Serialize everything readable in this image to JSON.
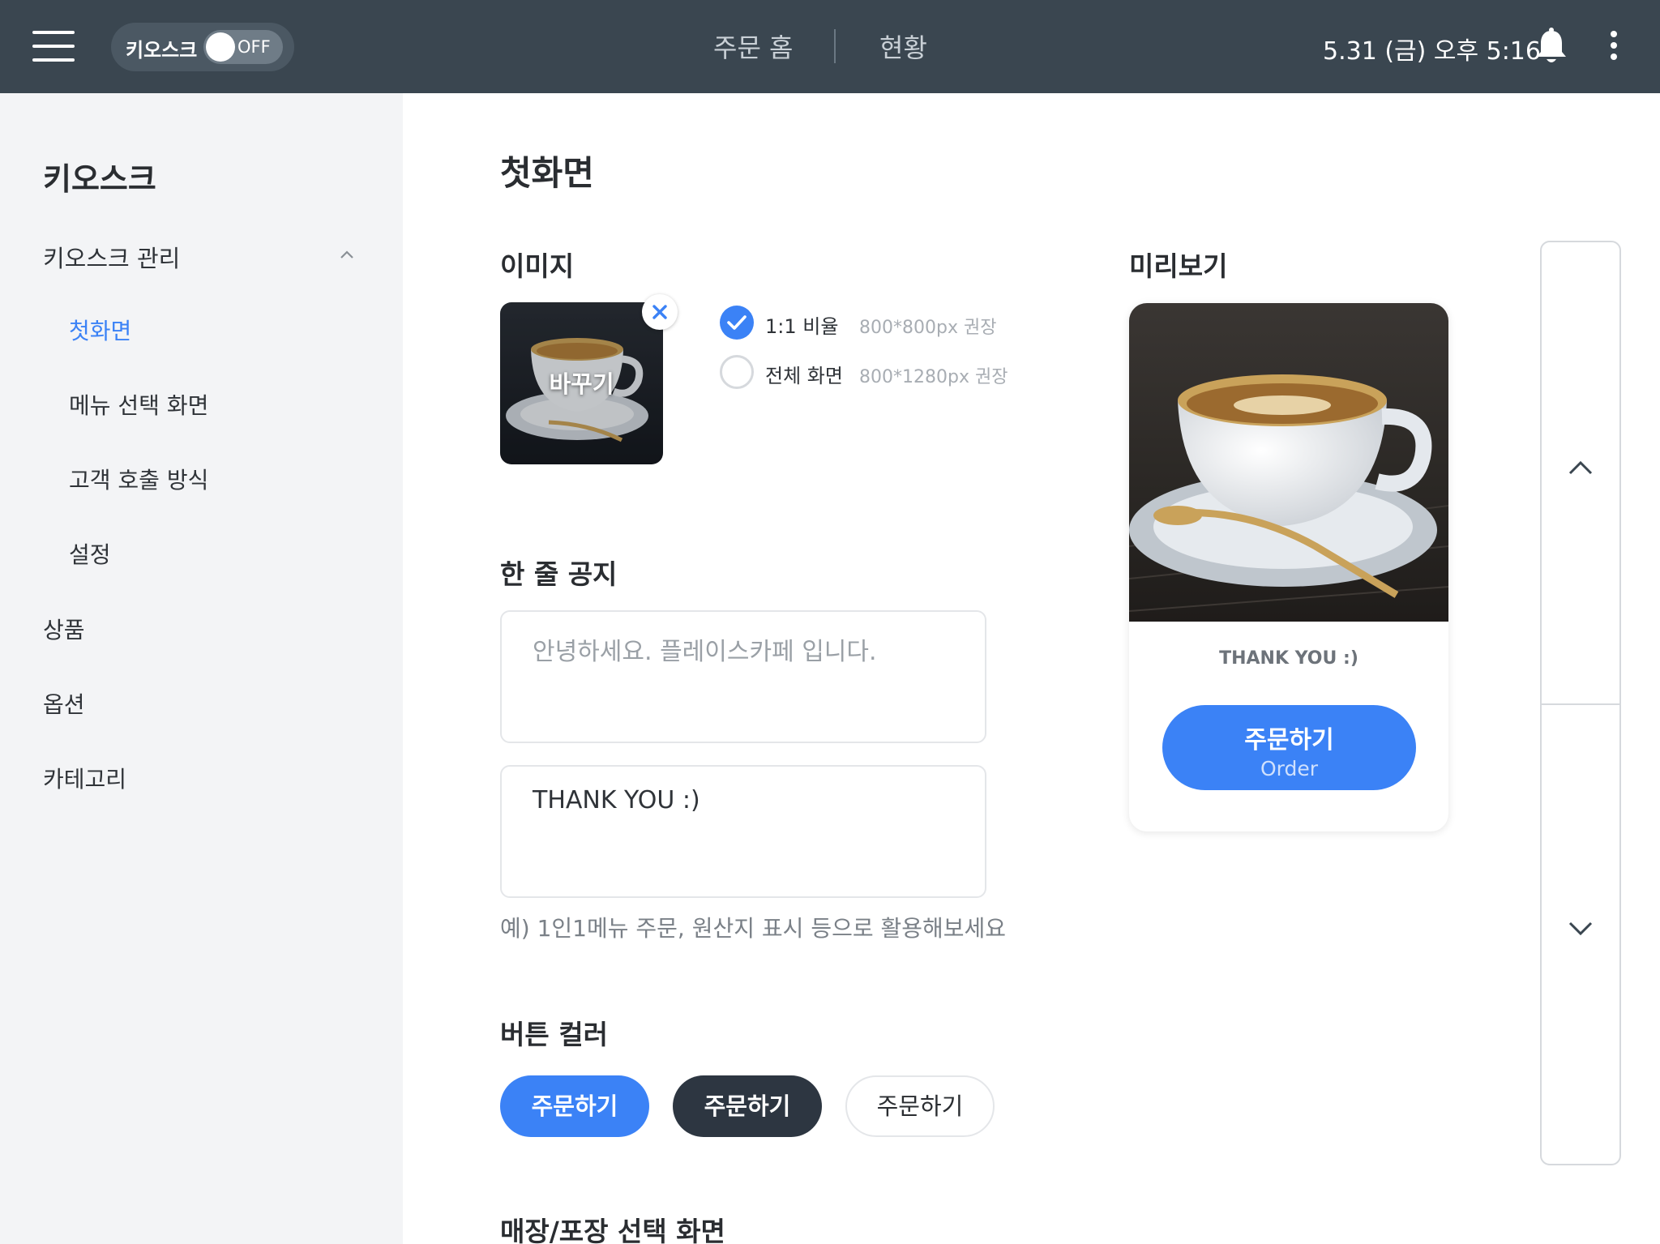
{
  "topbar": {
    "menu_icon": "hamburger-menu-icon",
    "kiosk_label": "키오스크",
    "toggle_state": "OFF",
    "nav_home": "주문 홈",
    "nav_status": "현황",
    "datetime": "5.31 (금) 오후 5:16",
    "bell_icon": "bell-icon",
    "more_icon": "more-vertical-icon"
  },
  "sidebar": {
    "title": "키오스크",
    "group_label": "키오스크 관리",
    "group_expanded": true,
    "sub_items": [
      "첫화면",
      "메뉴 선택 화면",
      "고객 호출 방식",
      "설정"
    ],
    "active_item": "첫화면",
    "top_items": [
      "상품",
      "옵션",
      "카테고리"
    ]
  },
  "main": {
    "title": "첫화면",
    "image_section": {
      "title": "이미지",
      "thumb_button": "바꾸기",
      "ratio_options": [
        {
          "label": "1:1 비율",
          "hint": "800*800px 권장",
          "selected": true
        },
        {
          "label": "전체 화면",
          "hint": "800*1280px 권장",
          "selected": false
        }
      ]
    },
    "notice_section": {
      "title": "한 줄 공지",
      "placeholder": "안녕하세요. 플레이스카페 입니다.",
      "value": "THANK YOU :)",
      "hint": "예) 1인1메뉴 주문, 원산지 표시 등으로 활용해보세요"
    },
    "color_section": {
      "title": "버튼 컬러",
      "options": [
        {
          "label": "주문하기",
          "color": "#3b82f6"
        },
        {
          "label": "주문하기",
          "color": "#2d3641"
        },
        {
          "label": "주문하기",
          "color": "#ffffff"
        }
      ]
    },
    "next_section_title": "매장/포장 선택 화면"
  },
  "preview": {
    "title": "미리보기",
    "notice": "THANK YOU :)",
    "order_ko": "주문하기",
    "order_en": "Order",
    "accent": "#3b82f6"
  },
  "scroller": {
    "up_icon": "chevron-up-icon",
    "down_icon": "chevron-down-icon"
  }
}
